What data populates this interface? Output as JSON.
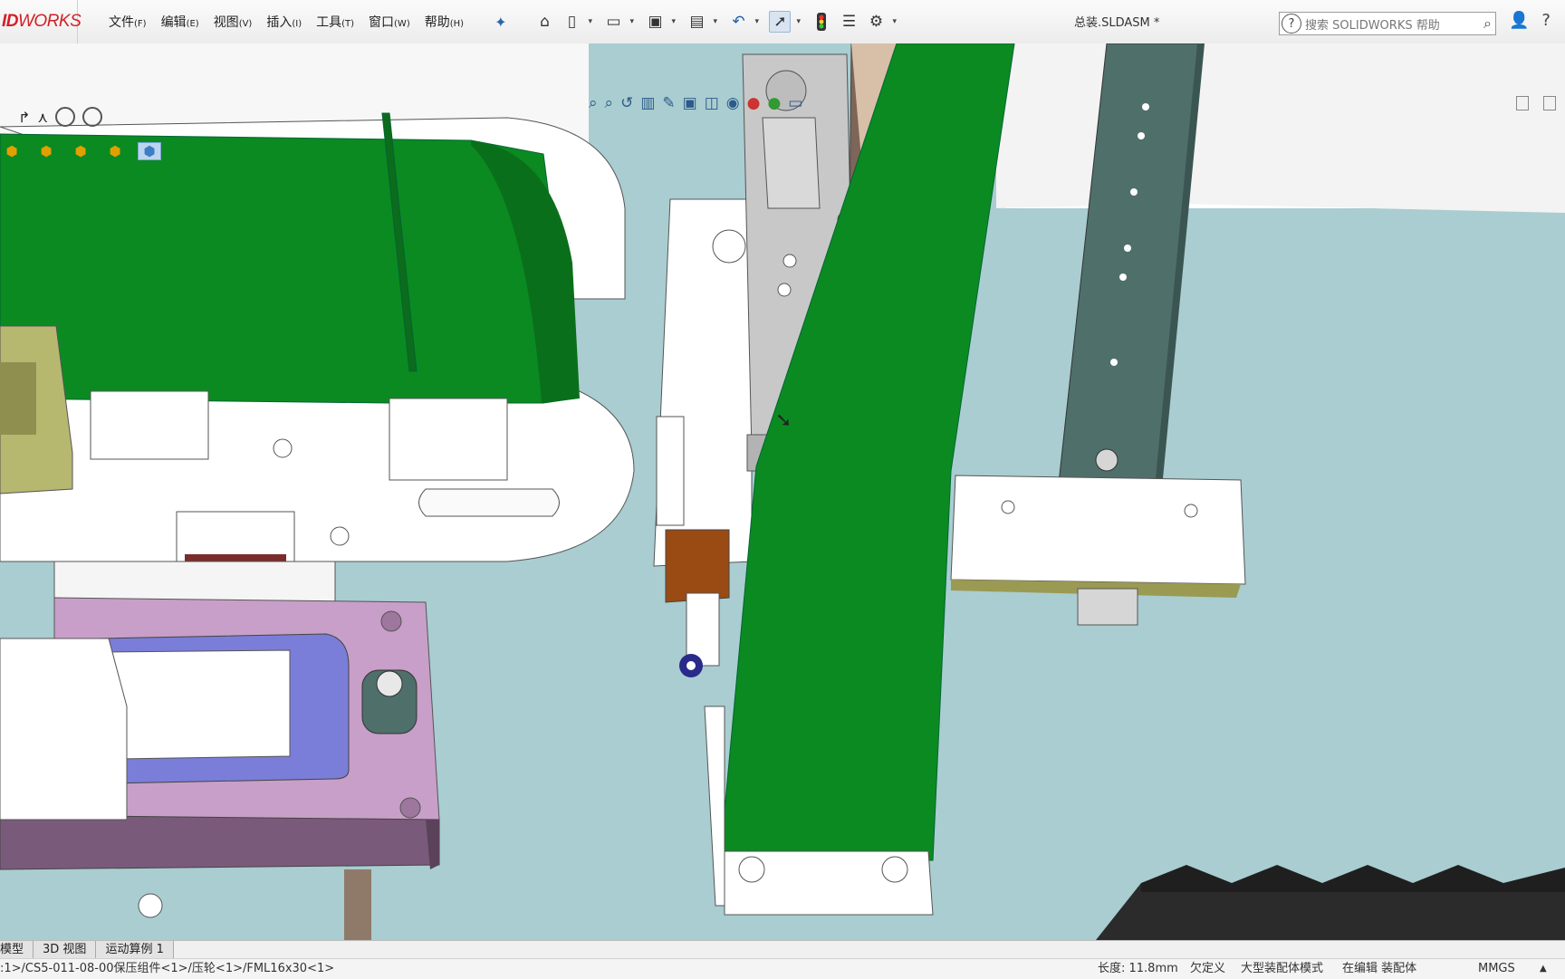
{
  "app": {
    "logo_prefix": "ID",
    "logo_suffix": "WORKS",
    "document_title": "总装.SLDASM *"
  },
  "menu": [
    {
      "label": "文件",
      "key": "(F)"
    },
    {
      "label": "编辑",
      "key": "(E)"
    },
    {
      "label": "视图",
      "key": "(V)"
    },
    {
      "label": "插入",
      "key": "(I)"
    },
    {
      "label": "工具",
      "key": "(T)"
    },
    {
      "label": "窗口",
      "key": "(W)"
    },
    {
      "label": "帮助",
      "key": "(H)"
    }
  ],
  "toolbar": {
    "icons": [
      "home-icon",
      "new-document-icon",
      "open-folder-icon",
      "save-icon",
      "print-icon",
      "undo-icon",
      "select-pointer-icon",
      "traffic-light-icon",
      "file-properties-icon",
      "options-gear-icon"
    ]
  },
  "search": {
    "placeholder": "搜索 SOLIDWORKS 帮助"
  },
  "bottom_tabs": [
    "模型",
    "3D 视图",
    "运动算例 1"
  ],
  "status": {
    "path": ":1>/CS5-011-08-00保压组件<1>/压轮<1>/FML16x30<1>",
    "length": "长度: 11.8mm",
    "definition": "欠定义",
    "mode": "大型装配体模式",
    "editing": "在编辑 装配体",
    "units": "MMGS",
    "caret": "▲"
  },
  "colors": {
    "background": "#a9cdd0",
    "belt_green": "#0a7a1c",
    "plate_purple": "#c49ac4",
    "rail_slate": "#4f6f6b",
    "logo_red": "#d31f26"
  }
}
